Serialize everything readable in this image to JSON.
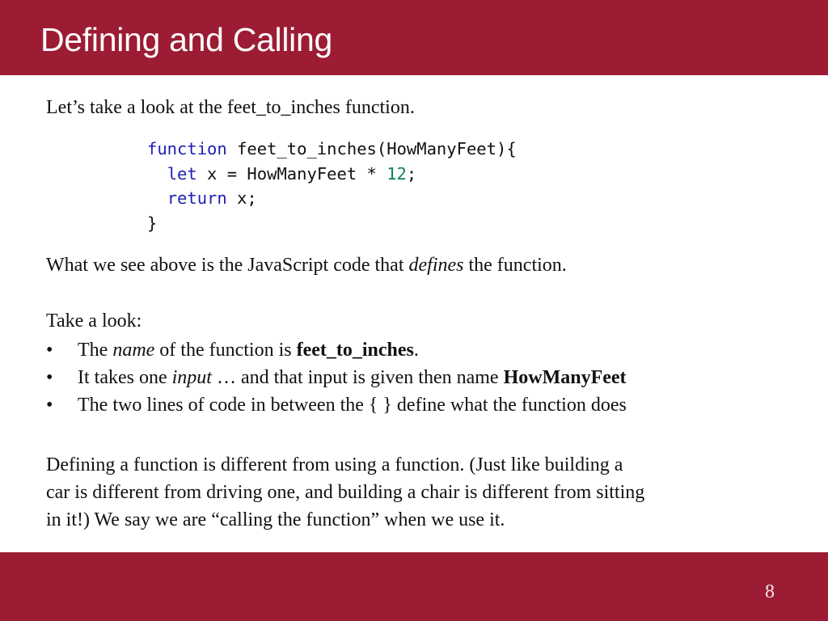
{
  "slide": {
    "title": "Defining and Calling",
    "page_number": "8",
    "colors": {
      "header_bg": "#9c1c33",
      "footer_bg": "#9c1c33",
      "keyword": "#1f1fb5",
      "number_literal": "#108060"
    }
  },
  "intro": "Let’s take a look at the feet_to_inches function.",
  "code": {
    "line1": {
      "keyword": "function",
      "rest": " feet_to_inches(HowManyFeet){"
    },
    "line2": {
      "indent": "  ",
      "keyword": "let",
      "rest_a": " x = HowManyFeet * ",
      "number": "12",
      "rest_b": ";"
    },
    "line3": {
      "indent": "  ",
      "keyword": "return",
      "rest": " x;"
    },
    "line4": "}"
  },
  "defines_para": {
    "before": "What we see above is the JavaScript code that ",
    "emphasis": "defines",
    "after": " the function."
  },
  "take_look": "Take a look:",
  "bullets": [
    {
      "marker": "•",
      "a": "The ",
      "em": "name",
      "b": " of the function is ",
      "strong": "feet_to_inches",
      "c": "."
    },
    {
      "marker": "•",
      "a": "It takes one ",
      "em": "input",
      "b": " … and that input is given then name ",
      "strong": "HowManyFeet",
      "c": ""
    },
    {
      "marker": "•",
      "a": "The two lines of code in between the { } define what the function does"
    }
  ],
  "closing": [
    "Defining a function is different from using a function.  (Just like building a",
    "car is different from driving one, and building a chair is different from sitting",
    "in it!)  We say we are “calling the function” when we use it."
  ]
}
